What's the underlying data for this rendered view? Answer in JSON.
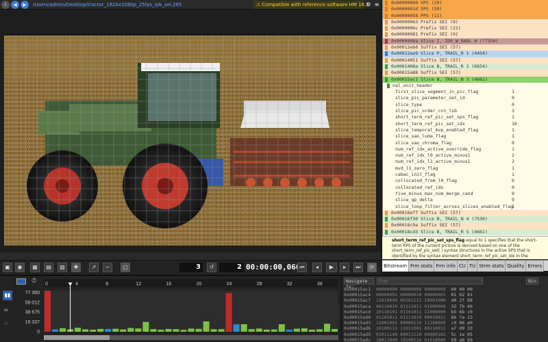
{
  "topbar": {
    "file_path": "/Users/admin/Desktop/tractor_1920x1080p_25fps_ipb_sei.265",
    "compat_text": "Compatible with reference software HM 16.5"
  },
  "controls": {
    "frame_jump": "3",
    "frame_num": "2",
    "timecode": "00:00:00,066"
  },
  "tree": {
    "nodes": [
      {
        "text": "0x00000000 VPS (29)",
        "bg": "#f7a64a",
        "mk": "#e57e17"
      },
      {
        "text": "0x0000001d SPS (59)",
        "bg": "#f7a64a",
        "mk": "#e57e17"
      },
      {
        "text": "0x00000058 PPS (11)",
        "bg": "#f7a64a",
        "mk": "#e57e17"
      },
      {
        "text": "0x00000063 Prefix SEI (9)",
        "bg": "#fde2c4",
        "mk": "#f09a3a"
      },
      {
        "text": "0x0000006c Prefix SEI (21)",
        "bg": "#fde2c4",
        "mk": "#f09a3a"
      },
      {
        "text": "0x00000081 Prefix SEI (9)",
        "bg": "#fde2c4",
        "mk": "#f09a3a"
      },
      {
        "text": "0x0000008a Slice I, IDR_W_RADL 0 (77350)",
        "bg": "#c79a9a",
        "mk": "#b03030"
      },
      {
        "text": "0x00012eb0 Suffix SEI (57)",
        "bg": "#fde2c4",
        "mk": "#f09a3a"
      },
      {
        "text": "0x00012ee9 Slice P, TRAIL_R 1 (4454)",
        "bg": "#b9d7f0",
        "mk": "#3b7fc4"
      },
      {
        "text": "0x00014051 Suffix SEI (57)",
        "bg": "#fde2c4",
        "mk": "#f09a3a"
      },
      {
        "text": "0x0001408a Slice B, TRAIL_R 2 (6654)",
        "bg": "#d9ecd0",
        "mk": "#3aa33a"
      },
      {
        "text": "0x00015a88 Suffix SEI (57)",
        "bg": "#fde2c4",
        "mk": "#f09a3a"
      },
      {
        "text": "0x00015ac1 Slice B, TRAIL_N 3 (4662)",
        "bg": "#8fd36a",
        "mk": "#2e9a2e"
      }
    ],
    "header_field": "nal_unit_header",
    "fields": [
      {
        "name": "first_slice_segment_in_pic_flag",
        "value": "1"
      },
      {
        "name": "slice_pic_parameter_set_id",
        "value": "0"
      },
      {
        "name": "slice_type",
        "value": "0"
      },
      {
        "name": "slice_pic_order_cnt_lsb",
        "value": "3"
      },
      {
        "name": "short_term_ref_pic_set_sps_flag",
        "value": "1"
      },
      {
        "name": "short_term_ref_pic_set_idx",
        "value": "10"
      },
      {
        "name": "slice_temporal_mvp_enabled_flag",
        "value": "1"
      },
      {
        "name": "slice_sao_luma_flag",
        "value": "1"
      },
      {
        "name": "slice_sao_chroma_flag",
        "value": "0"
      },
      {
        "name": "num_ref_idx_active_override_flag",
        "value": "1"
      },
      {
        "name": "num_ref_idx_l0_active_minus1",
        "value": "2"
      },
      {
        "name": "num_ref_idx_l1_active_minus1",
        "value": "2"
      },
      {
        "name": "mvd_l1_zero_flag",
        "value": "1"
      },
      {
        "name": "cabac_init_flag",
        "value": "1"
      },
      {
        "name": "collocated_from_l0_flag",
        "value": "0"
      },
      {
        "name": "collocated_ref_idx",
        "value": "0"
      },
      {
        "name": "five_minus_max_num_merge_cand",
        "value": "0"
      },
      {
        "name": "slice_qp_delta",
        "value": "9"
      },
      {
        "name": "slice_loop_filter_across_slices_enabled_flag",
        "value": "1"
      }
    ],
    "after_nodes": [
      {
        "text": "0x00016ef7 Suffix SEI (57)",
        "bg": "#fde2c4",
        "mk": "#f09a3a"
      },
      {
        "text": "0x00016f30 Slice B, TRAIL_N 4 (7530)",
        "bg": "#d9ecd0",
        "mk": "#3aa33a"
      },
      {
        "text": "0x00018c9a Suffix SEI (57)",
        "bg": "#fde2c4",
        "mk": "#f09a3a"
      },
      {
        "text": "0x00018cd3 Slice B, TRAIL_R 5 (4661)",
        "bg": "#d9ecd0",
        "mk": "#3aa33a"
      }
    ]
  },
  "desc": {
    "title": "short_term_ref_pic_set_sps_flag",
    "text": " equal to 1 specifies that the short-term RPS of the current picture is derived based on one of the short_term_ref_pic_set( ) syntax structures in the active SPS that is identified by the syntax element short_term_ref_pic_set_idx in the slice header."
  },
  "tabs": [
    "Bitstream",
    "Frm stats",
    "Frm info",
    "CU",
    "TU",
    "Strm stats",
    "Quality",
    "Errors"
  ],
  "chart_data": {
    "type": "bar",
    "ylabels": [
      "77 360",
      "58 012",
      "38 675",
      "19 337",
      "0"
    ],
    "xticks": [
      "0",
      "4",
      "8",
      "12",
      "16",
      "20",
      "24",
      "28",
      "32",
      "36"
    ],
    "ylim": [
      0,
      77360
    ],
    "series": [
      {
        "color": "#c02a2a",
        "values": [
          77350,
          0,
          0,
          0,
          0,
          0,
          0,
          0,
          0,
          0,
          0,
          0,
          0,
          0,
          0,
          0,
          0,
          0,
          0,
          0,
          0,
          0,
          0,
          0,
          73000,
          0,
          0,
          0,
          0,
          0,
          0,
          0,
          0,
          0,
          0,
          0,
          0,
          0,
          0
        ]
      },
      {
        "color": "#2b8ad1",
        "values": [
          0,
          4454,
          0,
          0,
          0,
          0,
          0,
          0,
          5200,
          0,
          0,
          0,
          0,
          0,
          0,
          0,
          0,
          0,
          0,
          0,
          0,
          0,
          0,
          0,
          0,
          14000,
          0,
          0,
          0,
          0,
          0,
          0,
          4000,
          0,
          0,
          0,
          0,
          0,
          0
        ]
      },
      {
        "color": "#7cc242",
        "values": [
          0,
          0,
          6654,
          4662,
          7530,
          4661,
          3800,
          5300,
          0,
          5600,
          4300,
          7100,
          6200,
          18500,
          4900,
          3900,
          5200,
          4800,
          3500,
          6000,
          5500,
          19500,
          4700,
          4800,
          0,
          0,
          14200,
          4900,
          6100,
          4000,
          4300,
          14100,
          0,
          5700,
          6400,
          3900,
          4600,
          15200,
          5200
        ]
      }
    ]
  },
  "bottom": {
    "nav_label": "Navigate to:",
    "find_placeholder": "Find",
    "bin_label": "Bin",
    "hex_rows": [
      {
        "addr": "0x00015ac1",
        "bits": "00000000 00000000 00000000",
        "hex": "00 00 00"
      },
      {
        "addr": "0x00015ac4",
        "bits": "00000001 00000010 00000001",
        "hex": "01 02 01"
      },
      {
        "addr": "0x00015ac7",
        "bits": "11010000 00101111 10001000",
        "hex": "d0 2f 88"
      },
      {
        "addr": "0x00015aca",
        "bits": "00110010 01111011 01000000",
        "hex": "32 7b 40"
      },
      {
        "addr": "0x00015acd",
        "bits": "10110101 01101011 11000000",
        "hex": "b5 6b c0"
      },
      {
        "addr": "0x00015ad0",
        "bits": "01101011 01111010 00010011",
        "hex": "6b 7a 13"
      },
      {
        "addr": "0x00015ad3",
        "bits": "11001001 00000110 11100000",
        "hex": "c9 06 e0"
      },
      {
        "addr": "0x00015ad6",
        "bits": "10100111 11011001 00110011",
        "hex": "a7 d9 33"
      },
      {
        "addr": "0x00015ad9",
        "bits": "01011100 00011110 00000101",
        "hex": "5c 1e 05"
      },
      {
        "addr": "0x00015adc",
        "bits": "10011000 10100110 01010000",
        "hex": "98 a6 50"
      }
    ]
  }
}
